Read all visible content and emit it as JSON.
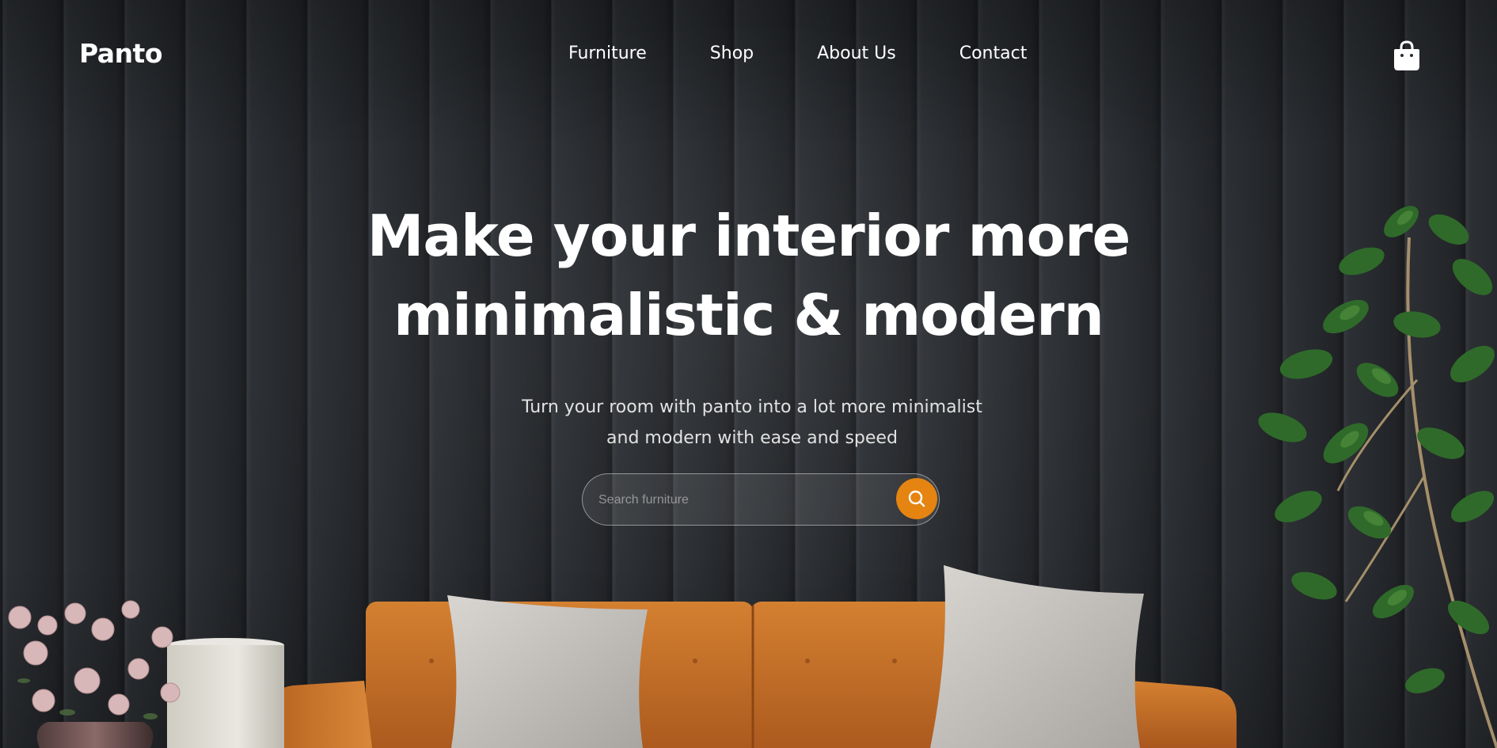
{
  "brand": {
    "logo": "Panto"
  },
  "nav": {
    "items": [
      {
        "label": "Furniture"
      },
      {
        "label": "Shop"
      },
      {
        "label": "About Us"
      },
      {
        "label": "Contact"
      }
    ],
    "cart_icon": "shopping-bag-icon"
  },
  "hero": {
    "title_line1": "Make your interior more",
    "title_line2": "minimalistic & modern",
    "subtitle_line1": "Turn your room with panto into a lot more minimalist",
    "subtitle_line2": "and modern with ease and speed"
  },
  "search": {
    "placeholder": "Search furniture",
    "value": "",
    "button_icon": "search-icon"
  },
  "colors": {
    "accent": "#e58411",
    "wall": "#2a2d31",
    "sofa": "#c6702a",
    "text": "#ffffff"
  }
}
